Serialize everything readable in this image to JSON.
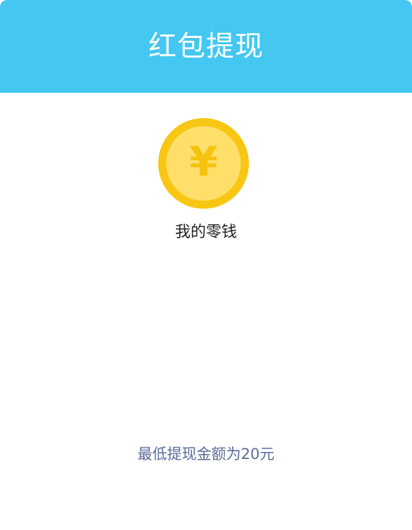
{
  "header": {
    "title": "红包提现"
  },
  "coin": {
    "icon": "yuan-coin-icon",
    "symbol": "¥",
    "colors": {
      "outer": "#f8c714",
      "inner": "#fddf6a",
      "symbol": "#f5c30f"
    }
  },
  "wallet": {
    "label": "我的零钱"
  },
  "footer": {
    "min_note": "最低提现金额为20元"
  },
  "colors": {
    "header_bg": "#44c7f0",
    "note_text": "#5c6b99"
  }
}
